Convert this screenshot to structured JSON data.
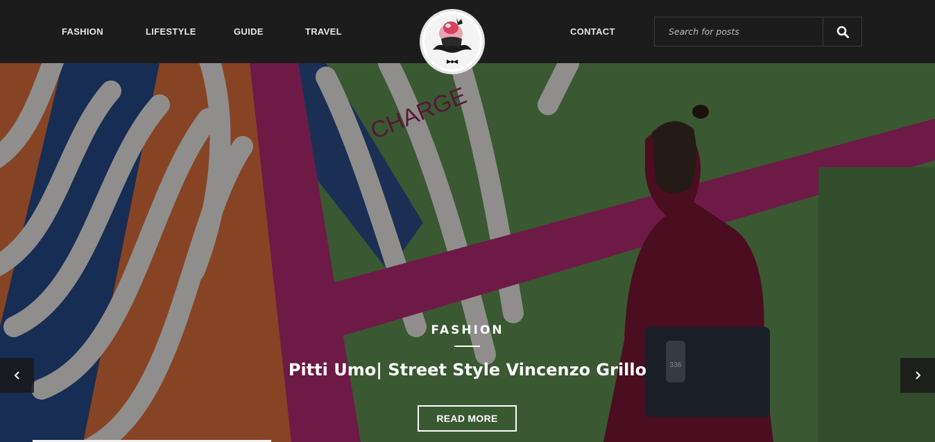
{
  "nav": {
    "left": [
      {
        "label": "FASHION"
      },
      {
        "label": "LIFESTYLE"
      },
      {
        "label": "GUIDE"
      },
      {
        "label": "TRAVEL"
      }
    ],
    "right": [
      {
        "label": "CONTACT"
      }
    ]
  },
  "logo": {
    "icon": "mustache-cupcake-logo"
  },
  "search": {
    "placeholder": "Search for posts",
    "value": "",
    "icon": "search-icon"
  },
  "slide": {
    "category": "FASHION",
    "title": "Pitti Umo| Street Style Vincenzo Grillo",
    "button_label": "READ MORE",
    "background_text": "CHARGE",
    "tag_number": "336"
  },
  "slider": {
    "prev_icon": "chevron-left-icon",
    "next_icon": "chevron-right-icon"
  },
  "colors": {
    "header_bg": "#1c1c1c",
    "text": "#ffffff",
    "nav_text": "#e6e6e6"
  }
}
